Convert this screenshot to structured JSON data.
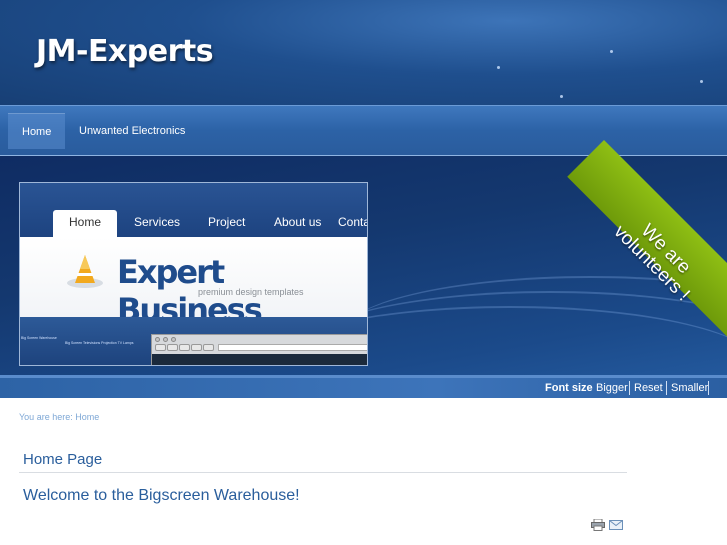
{
  "site": {
    "logo": "JM-Experts"
  },
  "nav": {
    "items": [
      {
        "label": "Home",
        "active": true
      },
      {
        "label": "Unwanted Electronics",
        "active": false
      }
    ]
  },
  "banner": {
    "ribbon_text": "We are volunteers !",
    "preview": {
      "tabs": [
        "Home",
        "Services",
        "Project",
        "About us",
        "Conta"
      ],
      "brand": "Expert Business",
      "tagline": "premium design templates",
      "strip_text_1": "Big Screen Warehouse",
      "strip_text_2": "Big Screen Televisions Projection TV Lamps"
    }
  },
  "font_size": {
    "label": "Font size",
    "bigger": "Bigger",
    "reset": "Reset",
    "smaller": "Smaller"
  },
  "breadcrumb": {
    "prefix": "You are here:",
    "current": "Home"
  },
  "main": {
    "page_title": "Home Page",
    "article_title": "Welcome to the Bigscreen Warehouse!"
  },
  "icons": [
    "print-icon",
    "email-icon"
  ],
  "colors": {
    "link_blue": "#2a5e9c",
    "ribbon_green": "#8fbf14",
    "header_blue": "#1f4f8e"
  }
}
